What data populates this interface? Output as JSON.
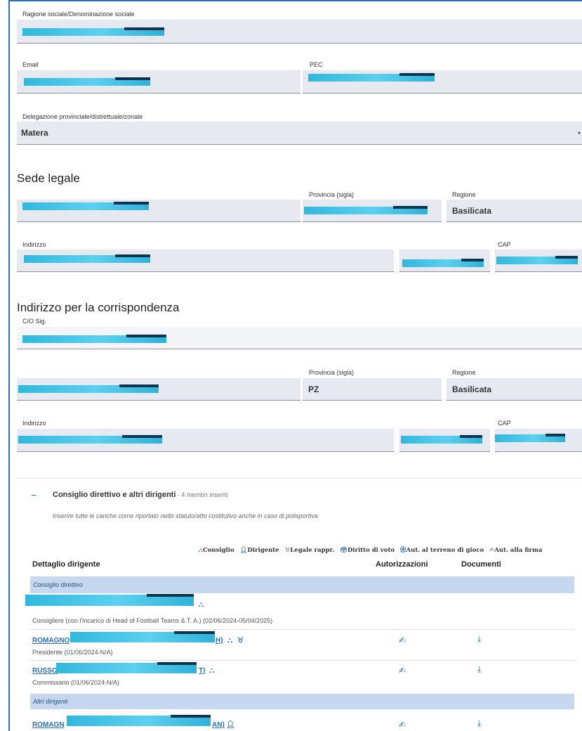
{
  "form": {
    "ragione_label": "Ragione sociale/Denominazione sociale",
    "email_label": "Email",
    "pec_label": "PEC",
    "delegazione_label": "Delegazione provinciale/distrettuale/zonale",
    "delegazione_value": "Matera"
  },
  "sede_legale": {
    "title": "Sede legale",
    "provincia_label": "Provincia (sigla)",
    "regione_label": "Regione",
    "regione_value": "Basilicata",
    "indirizzo_label": "Indirizzo",
    "cap_label": "CAP"
  },
  "corrispondenza": {
    "title": "Indirizzo per la corrispondenza",
    "co_label": "C/O Sig.",
    "provincia_label": "Provincia (sigla)",
    "provincia_value": "PZ",
    "regione_label": "Regione",
    "regione_value": "Basilicata",
    "indirizzo_label": "Indirizzo",
    "cap_label": "CAP"
  },
  "consiglio": {
    "toggle_symbol": "−",
    "title": "Consiglio direttivo e altri dirigenti",
    "count_text": " - 4 membri inseriti",
    "hint": "Inserire tutte le cariche come riportato nello statuto/atto costitutivo anche in caso di polisportiva",
    "legend": {
      "consiglio": "Consiglio",
      "dirigente": "Dirigente",
      "legale": "Legale rappr.",
      "voto": "Diritto di voto",
      "terreno": "Aut. al terreno di gioco",
      "firma": "Aut. alla firma"
    },
    "columns": {
      "dettaglio": "Dettaglio dirigente",
      "autorizzazioni": "Autorizzazioni",
      "documenti": "Documenti"
    },
    "group_direttivo": "Consiglio direttivo",
    "group_altri": "Altri dirigenti",
    "rows": [
      {
        "name": "",
        "suffix": "",
        "role": "Consigliere (con l'incarico di Head of Football Teams & T. A.) (02/06/2024-05/04/2025)"
      },
      {
        "name": "ROMAGNO",
        "suffix": "H)",
        "role": "Presidente (01/06/2024-N/A)"
      },
      {
        "name": "RUSSO",
        "suffix": "T)",
        "role": "Commissario (01/06/2024-N/A)"
      },
      {
        "name": "ROMAGN",
        "suffix": "AN)",
        "role": ""
      }
    ]
  },
  "colors": {
    "accent": "#2b6fb5",
    "field_bg": "#e6e9f0",
    "group_bg": "#c5d8f0"
  }
}
